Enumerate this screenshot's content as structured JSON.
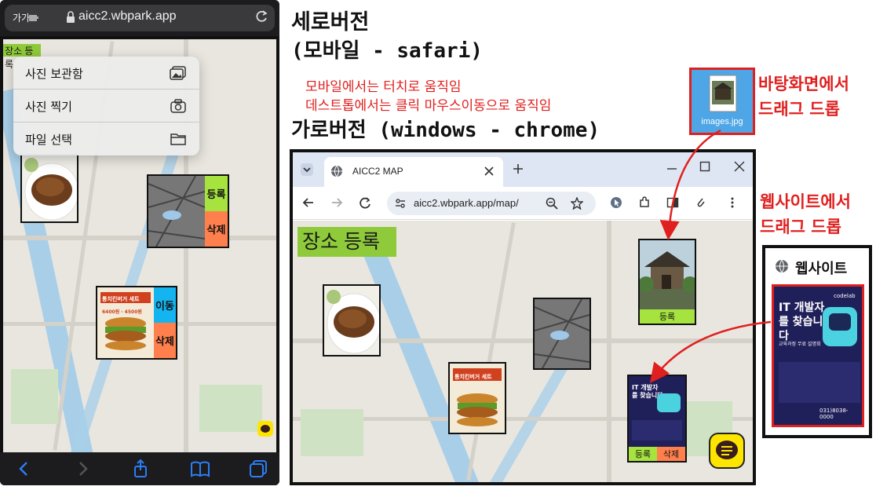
{
  "headings": {
    "portrait_line1": "세로버전",
    "portrait_line2": "(모바일 - safari)",
    "note_line1": "모바일에서는 터치로 움직임",
    "note_line2": "데스트톱에서는 클릭 마우스이동으로 움직임",
    "landscape": "가로버전 (windows - chrome)",
    "desktop_drop_line1": "바탕화면에서",
    "desktop_drop_line2": "드래그 드롭",
    "web_drop_line1": "웹사이트에서",
    "web_drop_line2": "드래그 드롭"
  },
  "mobile": {
    "text_size_label": "가가",
    "url": "aicc2.wbpark.app",
    "place_button": "장소 등록",
    "menu": [
      {
        "label": "사진 보관함",
        "icon": "photo-library-icon"
      },
      {
        "label": "사진 찍기",
        "icon": "camera-icon"
      },
      {
        "label": "파일 선택",
        "icon": "folder-icon"
      }
    ],
    "card_register": "등록",
    "card_delete": "삭제",
    "card_move": "이동",
    "burger_title": "통치킨버거 세트",
    "burger_price": "6400원 · 4500원"
  },
  "desktop": {
    "tab_title": "AICC2 MAP",
    "url": "aicc2.wbpark.app/map/",
    "place_button": "장소 등록",
    "card_register": "등록",
    "card_delete": "삭제",
    "poster_title": "IT 개발자를 찾습니다",
    "burger_title": "통치킨버거 세트"
  },
  "file_icon": {
    "label": "images.jpg"
  },
  "website": {
    "title": "웹사이트",
    "poster_title": "IT 개발자를 찾습니다",
    "poster_brand": "codelab",
    "poster_sub": "교육과정 무료 설명회",
    "poster_phone": "031)8038-0000"
  },
  "colors": {
    "accent_red": "#e0201f",
    "place_green": "#8fca3a",
    "tag_green": "#a6e33f",
    "tag_orange": "#ff7f4d",
    "tag_blue": "#14b4f0",
    "kakao_yellow": "#fee500"
  }
}
